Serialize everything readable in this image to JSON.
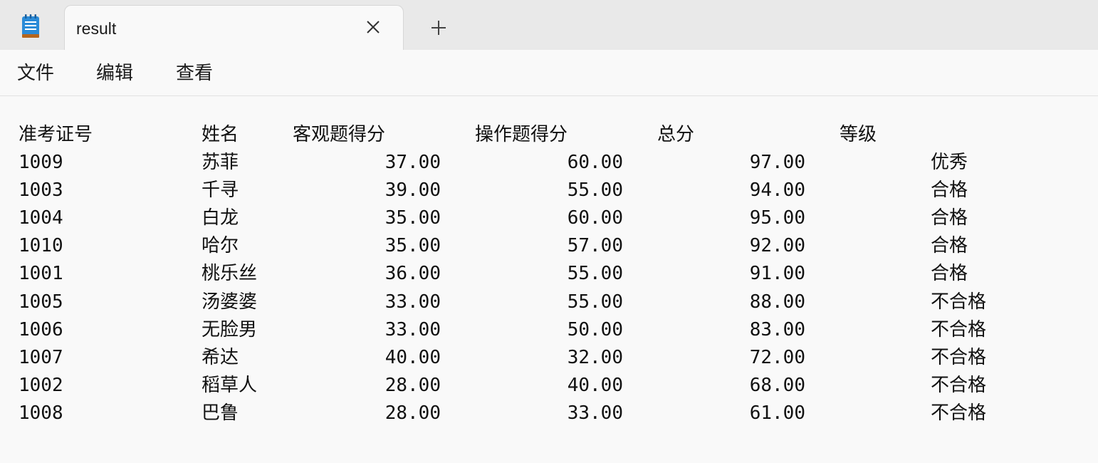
{
  "tab": {
    "title": "result"
  },
  "menu": {
    "items": [
      "文件",
      "编辑",
      "查看"
    ]
  },
  "table": {
    "headers": [
      "准考证号",
      "姓名",
      "客观题得分",
      "操作题得分",
      "总分",
      "等级"
    ],
    "rows": [
      [
        "1009",
        "苏菲",
        "37.00",
        "60.00",
        "97.00",
        "优秀"
      ],
      [
        "1003",
        "千寻",
        "39.00",
        "55.00",
        "94.00",
        "合格"
      ],
      [
        "1004",
        "白龙",
        "35.00",
        "60.00",
        "95.00",
        "合格"
      ],
      [
        "1010",
        "哈尔",
        "35.00",
        "57.00",
        "92.00",
        "合格"
      ],
      [
        "1001",
        "桃乐丝",
        "36.00",
        "55.00",
        "91.00",
        "合格"
      ],
      [
        "1005",
        "汤婆婆",
        "33.00",
        "55.00",
        "88.00",
        "不合格"
      ],
      [
        "1006",
        "无脸男",
        "33.00",
        "50.00",
        "83.00",
        "不合格"
      ],
      [
        "1007",
        "希达",
        "40.00",
        "32.00",
        "72.00",
        "不合格"
      ],
      [
        "1002",
        "稻草人",
        "28.00",
        "40.00",
        "68.00",
        "不合格"
      ],
      [
        "1008",
        "巴鲁",
        "28.00",
        "33.00",
        "61.00",
        "不合格"
      ]
    ]
  }
}
